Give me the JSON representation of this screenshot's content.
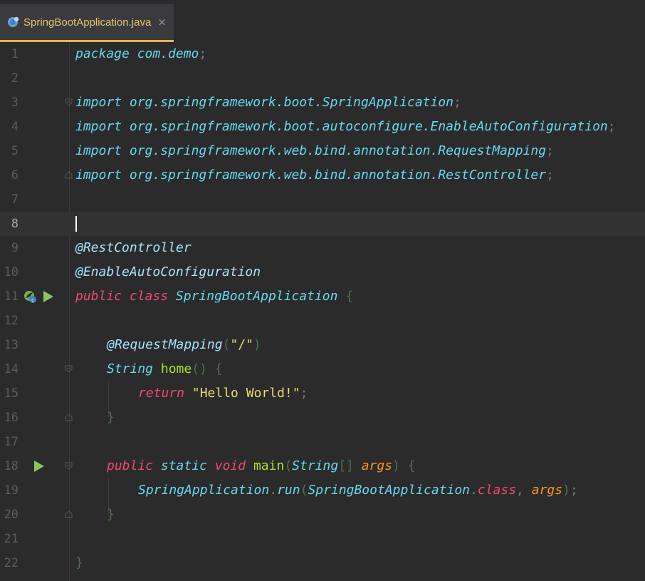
{
  "tab": {
    "file_name": "SpringBootApplication.java",
    "close_glyph": "×",
    "icon": "java-class-file-icon"
  },
  "editor": {
    "current_line": 8,
    "line_numbers": [
      "1",
      "2",
      "3",
      "4",
      "5",
      "6",
      "7",
      "8",
      "9",
      "10",
      "11",
      "12",
      "13",
      "14",
      "15",
      "16",
      "17",
      "18",
      "19",
      "20",
      "21",
      "22"
    ],
    "code": {
      "l1": {
        "kw": "package",
        "pkg": " com.demo",
        "semi": ";"
      },
      "l3": {
        "kw": "import",
        "path": " org.springframework.boot.SpringApplication",
        "semi": ";"
      },
      "l4": {
        "kw": "import",
        "path": " org.springframework.boot.autoconfigure.EnableAutoConfiguration",
        "semi": ";"
      },
      "l5": {
        "kw": "import",
        "path": " org.springframework.web.bind.annotation.RequestMapping",
        "semi": ";"
      },
      "l6": {
        "kw": "import",
        "path": " org.springframework.web.bind.annotation.RestController",
        "semi": ";"
      },
      "l9": {
        "ann": "@RestController"
      },
      "l10": {
        "ann": "@EnableAutoConfiguration"
      },
      "l11": {
        "kw1": "public",
        "kw2": "class",
        "name": "SpringBootApplication",
        "brace": "{"
      },
      "l13": {
        "ann": "@RequestMapping",
        "open": "(",
        "str": "\"/\"",
        "close": ")"
      },
      "l14": {
        "type": "String",
        "fn": "home",
        "parens": "()",
        "brace": "{"
      },
      "l15": {
        "kw": "return",
        "str": "\"Hello World!\"",
        "semi": ";"
      },
      "l16": {
        "brace": "}"
      },
      "l18": {
        "kw1": "public",
        "kw2": "static",
        "kw3": "void",
        "fn": "main",
        "open": "(",
        "type": "String",
        "arr": "[]",
        "param": "args",
        "close": ")",
        "brace": "{"
      },
      "l19": {
        "cls": "SpringApplication",
        "dot": ".",
        "method": "run",
        "open": "(",
        "arg1": "SpringBootApplication",
        "dot2": ".",
        "kwclass": "class",
        "comma": ",",
        "arg2": "args",
        "close": ")",
        "semi": ";"
      },
      "l20": {
        "brace": "}"
      },
      "l22": {
        "brace": "}"
      }
    }
  },
  "colors": {
    "background": "#2b2b2b",
    "tab_active_underline": "#e6b450",
    "keyword": "#f14a72",
    "string": "#e6db74",
    "function": "#a6e22e",
    "type": "#66d9ef",
    "parameter": "#fd971f"
  }
}
